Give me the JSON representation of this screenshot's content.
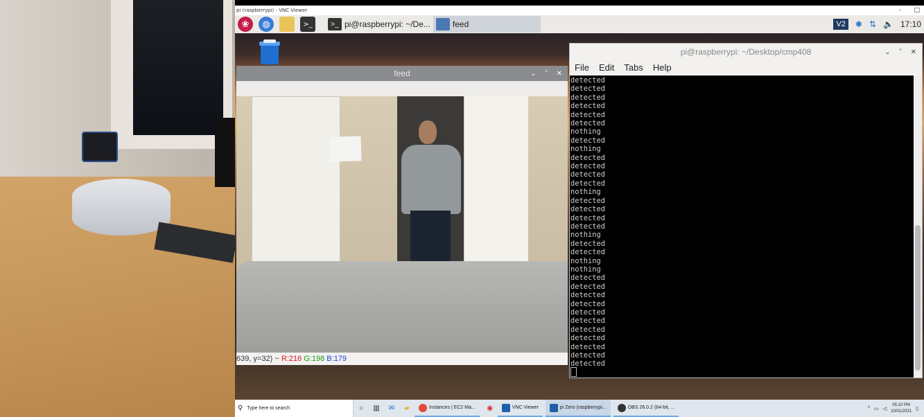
{
  "vnc_window": {
    "title": "pi (raspberrypi) - VNC Viewer",
    "controls": [
      "-",
      "□"
    ]
  },
  "pi_panel": {
    "tasks": [
      {
        "label": "pi@raspberrypi: ~/De..."
      },
      {
        "label": "feed"
      }
    ],
    "clock": "17:10",
    "icons": [
      "raspberry-menu-icon",
      "web-browser-icon",
      "file-manager-icon",
      "terminal-icon",
      "vnc-icon",
      "bluetooth-icon",
      "network-icon",
      "volume-icon"
    ]
  },
  "feed_window": {
    "title": "feed",
    "status": {
      "coords": "639, y=32) ~",
      "r": "R:216",
      "g": "G:198",
      "b": "B:179"
    }
  },
  "terminal_window": {
    "title": "pi@raspberrypi: ~/Desktop/cmp408",
    "menu": [
      "File",
      "Edit",
      "Tabs",
      "Help"
    ],
    "lines": [
      "detected",
      "detected",
      "detected",
      "detected",
      "detected",
      "detected",
      "nothing",
      "detected",
      "nothing",
      "detected",
      "detected",
      "detected",
      "detected",
      "nothing",
      "detected",
      "detected",
      "detected",
      "detected",
      "nothing",
      "detected",
      "detected",
      "nothing",
      "nothing",
      "detected",
      "detected",
      "detected",
      "detected",
      "detected",
      "detected",
      "detected",
      "detected",
      "detected",
      "detected",
      "detected"
    ]
  },
  "windows_taskbar": {
    "search_placeholder": "Type here to search",
    "apps": [
      {
        "label": "Instances | EC2 Ma..."
      },
      {
        "label": "VNC Viewer"
      },
      {
        "label": "pi Zero (raspberrypi..."
      },
      {
        "label": "OBS 26.0.2 (64-bit, ..."
      }
    ],
    "time": "05:10 PM",
    "date": "10/01/2021"
  },
  "colors": {
    "terminal_bg": "#000000",
    "terminal_fg": "#cfcfcf",
    "feed_titlebar": "#8b8c90",
    "status_r": "#d11111",
    "status_g": "#1a9a1a",
    "status_b": "#1a3fd1"
  }
}
